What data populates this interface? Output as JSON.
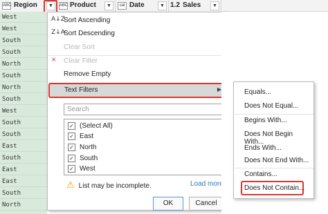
{
  "headers": [
    {
      "type_icon": "ABC",
      "name": "Region"
    },
    {
      "type_icon": "ABC",
      "name": "Product"
    },
    {
      "type_icon": "cal",
      "name": "Date"
    },
    {
      "type_icon": "1.2",
      "name": "Sales"
    }
  ],
  "regions": [
    "West",
    "West",
    "South",
    "South",
    "North",
    "South",
    "North",
    "South",
    "West",
    "South",
    "South",
    "East",
    "South",
    "East",
    "East",
    "South",
    "North"
  ],
  "menu": {
    "sort_asc": "Sort Ascending",
    "sort_desc": "Sort Descending",
    "clear_sort": "Clear Sort",
    "clear_filter": "Clear Filter",
    "remove_empty": "Remove Empty",
    "text_filters": "Text Filters",
    "search_placeholder": "Search",
    "list_items": [
      {
        "label": "(Select All)",
        "checked": true
      },
      {
        "label": "East",
        "checked": true
      },
      {
        "label": "North",
        "checked": true
      },
      {
        "label": "South",
        "checked": true
      },
      {
        "label": "West",
        "checked": true
      }
    ],
    "warning": "List may be incomplete.",
    "load_more": "Load more",
    "ok": "OK",
    "cancel": "Cancel"
  },
  "submenu": {
    "items": [
      "Equals...",
      "Does Not Equal...",
      "Begins With...",
      "Does Not Begin With...",
      "Ends With...",
      "Does Not End With...",
      "Contains...",
      "Does Not Contain..."
    ]
  }
}
